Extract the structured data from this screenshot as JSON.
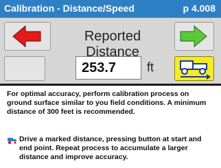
{
  "header": {
    "title": "Calibration - Distance/Speed",
    "page": "p 4.008"
  },
  "panel": {
    "field_label": "Reported Distance",
    "value": "253.7",
    "unit": "ft"
  },
  "buttons": {
    "prev_icon": "left-arrow-red",
    "next_icon": "right-arrow-green",
    "calibrate_icon": "vehicle-distance-icon"
  },
  "instructions": {
    "paragraph": "For optimal accuracy, perform calibration process on ground surface similar to you field conditions.  A minimum distance of 300 feet is recommended.",
    "tip": "Drive a marked distance, pressing button at start and end point.  Repeat process to accumulate a larger distance and improve accuracy."
  },
  "colors": {
    "titlebar": "#2f7fc4",
    "panel": "#d6d6d6",
    "prev_arrow": "#e21b1b",
    "next_arrow": "#5ac83a",
    "calibrate_button": "#f4ea2a"
  }
}
